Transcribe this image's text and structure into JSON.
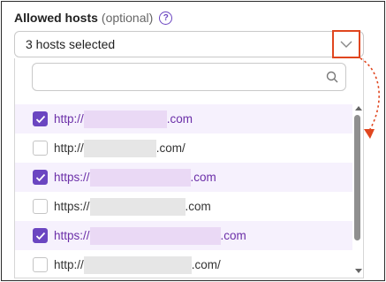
{
  "field": {
    "label": "Allowed hosts",
    "optional_text": "(optional)",
    "help_icon": "question-circle-icon",
    "help_glyph": "?"
  },
  "select": {
    "value": "3 hosts selected",
    "chevron_icon": "chevron-down-icon"
  },
  "search": {
    "placeholder": "",
    "icon": "search-icon"
  },
  "hosts": [
    {
      "prefix": "http://",
      "suffix": ".com",
      "checked": true
    },
    {
      "prefix": "http://",
      "suffix": ".com/",
      "checked": false
    },
    {
      "prefix": "https://",
      "suffix": ".com",
      "checked": true
    },
    {
      "prefix": "https://",
      "suffix": ".com",
      "checked": false
    },
    {
      "prefix": "https://",
      "suffix": ".com",
      "checked": true
    },
    {
      "prefix": "http://",
      "suffix": ".com/",
      "checked": false
    }
  ],
  "colors": {
    "accent": "#6b46c1",
    "selected_row": "#f6f1fd",
    "highlight_box": "#e0461f",
    "annotation_arrow": "#e0461f"
  }
}
